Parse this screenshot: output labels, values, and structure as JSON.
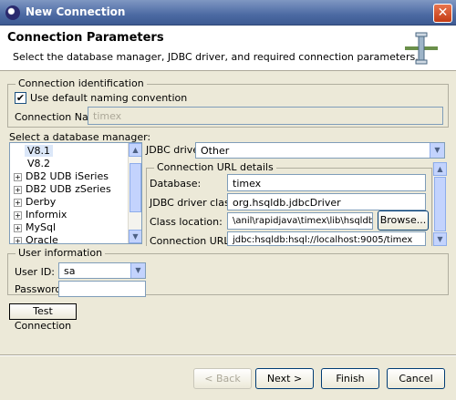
{
  "window": {
    "title": "New Connection",
    "close": "✕"
  },
  "header": {
    "title": "Connection Parameters",
    "description": "Select the database manager, JDBC driver, and required connection parameters."
  },
  "identification": {
    "legend": "Connection identification",
    "use_default_label": "Use default naming convention",
    "use_default_checked": true,
    "name_label": "Connection Name:",
    "name_value": "timex"
  },
  "db_manager": {
    "label": "Select a database manager:",
    "items": [
      {
        "label": "V8.1",
        "expander": "",
        "selected": true
      },
      {
        "label": "V8.2",
        "expander": ""
      },
      {
        "label": "DB2 UDB iSeries",
        "expander": "+"
      },
      {
        "label": "DB2 UDB zSeries",
        "expander": "+"
      },
      {
        "label": "Derby",
        "expander": "+"
      },
      {
        "label": "Informix",
        "expander": "+"
      },
      {
        "label": "MySql",
        "expander": "+"
      },
      {
        "label": "Oracle",
        "expander": "+"
      }
    ]
  },
  "jdbc": {
    "label": "JDBC driver:",
    "value": "Other"
  },
  "url_details": {
    "legend": "Connection URL details",
    "database_label": "Database:",
    "database_value": "timex",
    "driver_class_label": "JDBC driver class:",
    "driver_class_value": "org.hsqldb.jdbcDriver",
    "class_location_label": "Class location:",
    "class_location_value": "\\anil\\rapidjava\\timex\\lib\\hsqldb.jar",
    "browse_label": "Browse...",
    "url_label": "Connection URL:",
    "url_value": "jdbc:hsqldb:hsql://localhost:9005/timex"
  },
  "user_info": {
    "legend": "User information",
    "user_label": "User ID:",
    "user_value": "sa",
    "password_label": "Password:",
    "password_value": ""
  },
  "test_connection_label": "Test Connection",
  "nav": {
    "back": "< Back",
    "next": "Next >",
    "finish": "Finish",
    "cancel": "Cancel"
  }
}
